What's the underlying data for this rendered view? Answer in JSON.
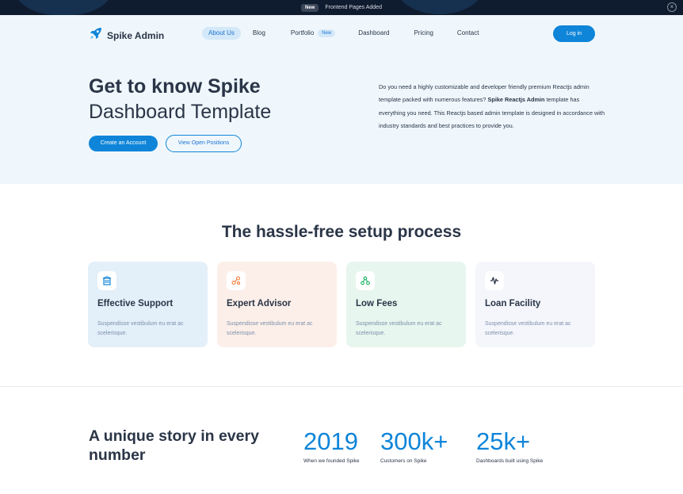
{
  "announcement": {
    "badge": "New",
    "message": "Frontend Pages Added"
  },
  "brand": {
    "name": "Spike Admin",
    "accent": "#0f85d9"
  },
  "nav": {
    "items": [
      {
        "label": "About Us",
        "active": true
      },
      {
        "label": "Blog"
      },
      {
        "label": "Portfolio",
        "badge": "New"
      },
      {
        "label": "Dashboard"
      },
      {
        "label": "Pricing"
      },
      {
        "label": "Contact"
      }
    ],
    "login_label": "Log in"
  },
  "hero": {
    "title_line1": "Get to know Spike",
    "title_line2": "Dashboard Template",
    "primary_button": "Create an Account",
    "secondary_button": "View Open Positions",
    "description_part1": "Do you need a highly customizable and developer friendly premium Reactjs admin template packed with numerous features? ",
    "description_bold": "Spike Reactjs Admin",
    "description_part2": " template has everything you need. This Reactjs based admin template is designed in accordance with industry standards and best practices to provide you."
  },
  "setup": {
    "title": "The hassle-free setup process",
    "cards": [
      {
        "title": "Effective Support",
        "description": "Suspendisse vestibulum eu erat ac scelerisque.",
        "icon": "building-icon",
        "bg": "#e3eff9",
        "color": "#0f85d9"
      },
      {
        "title": "Expert Advisor",
        "description": "Suspendisse vestibulum eu erat ac scelerisque.",
        "icon": "share-icon",
        "bg": "#fcefe9",
        "color": "#f8772f"
      },
      {
        "title": "Low Fees",
        "description": "Suspendisse vestibulum eu erat ac scelerisque.",
        "icon": "nodes-icon",
        "bg": "#e7f6ee",
        "color": "#13b05f"
      },
      {
        "title": "Loan Facility",
        "description": "Suspendisse vestibulum eu erat ac scelerisque.",
        "icon": "activity-icon",
        "bg": "#f4f6fb",
        "color": "#2a3547"
      }
    ]
  },
  "story": {
    "title": "A unique story in every number",
    "stats": [
      {
        "value": "2019",
        "label": "When we founded Spike"
      },
      {
        "value": "300k+",
        "label": "Customers on Spike"
      },
      {
        "value": "25k+",
        "label": "Dashboards built using Spike"
      }
    ]
  }
}
